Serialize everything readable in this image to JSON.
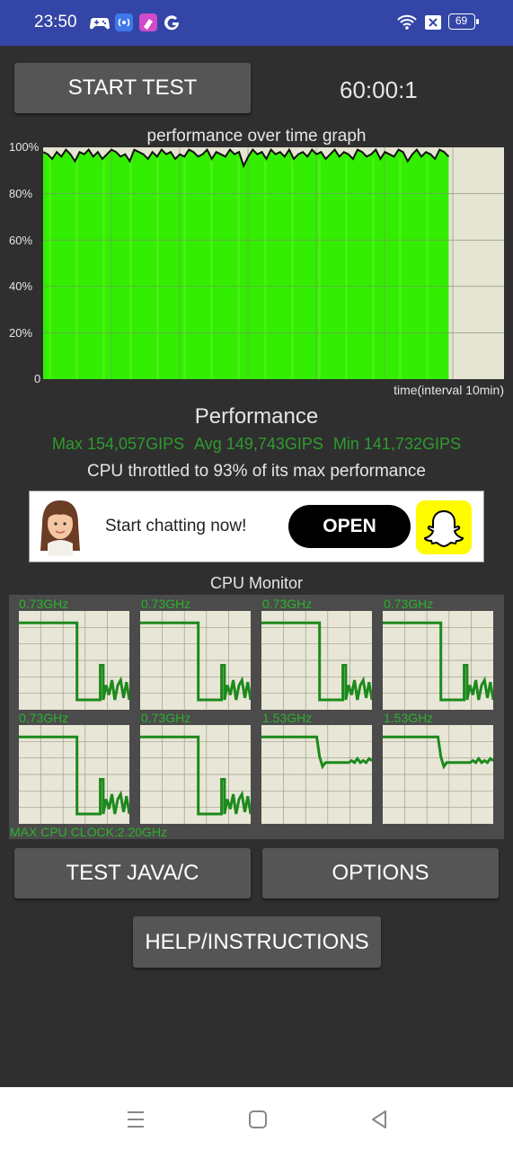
{
  "status_bar": {
    "time": "23:50",
    "battery": "69",
    "icons": [
      "gamepad-icon",
      "hotspot-icon",
      "app-icon",
      "google-icon",
      "wifi-icon",
      "close-box-icon",
      "battery-icon"
    ]
  },
  "controls": {
    "start_label": "START TEST",
    "timer": "60:00:1"
  },
  "graph": {
    "title": "performance over time graph",
    "y_ticks": [
      "100%",
      "80%",
      "60%",
      "40%",
      "20%",
      "0"
    ],
    "x_label": "time(interval 10min)"
  },
  "chart_data": {
    "type": "area",
    "title": "performance over time graph",
    "xlabel": "time(interval 10min)",
    "ylabel": "",
    "ylim": [
      0,
      100
    ],
    "y_ticks": [
      "0",
      "20%",
      "40%",
      "60%",
      "80%",
      "100%"
    ],
    "fill_color": "#33ee00",
    "line_color": "#111111",
    "filled_fraction_of_x": 0.88,
    "values": [
      98,
      97,
      95,
      98,
      96,
      99,
      97,
      94,
      98,
      97,
      99,
      96,
      98,
      95,
      97,
      99,
      98,
      96,
      97,
      94,
      99,
      98,
      97,
      95,
      98,
      96,
      99,
      97,
      98,
      95,
      97,
      96,
      99,
      98,
      96,
      97,
      99,
      95,
      98,
      97,
      96,
      99,
      97,
      98,
      92,
      96,
      99,
      97,
      98,
      95,
      99,
      97,
      98,
      96,
      99,
      95,
      97,
      98,
      96,
      99,
      97,
      98,
      95,
      97,
      99,
      96,
      98,
      97,
      95,
      99,
      98,
      96,
      97,
      99,
      95,
      98,
      97,
      96,
      99,
      98,
      94,
      97,
      99,
      96,
      98,
      97,
      95,
      99,
      98,
      96
    ]
  },
  "performance": {
    "title": "Performance",
    "max": "Max 154,057GIPS",
    "avg": "Avg 149,743GIPS",
    "min": "Min 141,732GIPS",
    "throttle": "CPU throttled to 93% of its max performance"
  },
  "ad": {
    "text": "Start chatting now!",
    "button": "OPEN"
  },
  "cpu_monitor": {
    "title": "CPU Monitor",
    "cores": [
      {
        "label": "0.73GHz",
        "values": [
          0.88,
          0.88,
          0.88,
          0.88,
          0.88,
          0.88,
          0.88,
          0.88,
          0.88,
          0.88,
          0.88,
          0.88,
          0.88,
          0.88,
          0.88,
          0.88,
          0.88,
          0.88,
          0.88,
          0.88,
          0.1,
          0.1,
          0.1,
          0.1,
          0.1,
          0.1,
          0.1,
          0.1,
          0.45,
          0.1,
          0.25,
          0.15,
          0.3,
          0.1,
          0.25,
          0.3,
          0.12,
          0.28,
          0.1
        ]
      },
      {
        "label": "0.73GHz",
        "values": [
          0.88,
          0.88,
          0.88,
          0.88,
          0.88,
          0.88,
          0.88,
          0.88,
          0.88,
          0.88,
          0.88,
          0.88,
          0.88,
          0.88,
          0.88,
          0.88,
          0.88,
          0.88,
          0.88,
          0.88,
          0.1,
          0.1,
          0.1,
          0.1,
          0.1,
          0.1,
          0.1,
          0.1,
          0.45,
          0.1,
          0.25,
          0.15,
          0.3,
          0.1,
          0.25,
          0.3,
          0.12,
          0.28,
          0.1
        ]
      },
      {
        "label": "0.73GHz",
        "values": [
          0.88,
          0.88,
          0.88,
          0.88,
          0.88,
          0.88,
          0.88,
          0.88,
          0.88,
          0.88,
          0.88,
          0.88,
          0.88,
          0.88,
          0.88,
          0.88,
          0.88,
          0.88,
          0.88,
          0.88,
          0.1,
          0.1,
          0.1,
          0.1,
          0.1,
          0.1,
          0.1,
          0.1,
          0.45,
          0.1,
          0.25,
          0.15,
          0.3,
          0.1,
          0.25,
          0.3,
          0.12,
          0.28,
          0.1
        ]
      },
      {
        "label": "0.73GHz",
        "values": [
          0.88,
          0.88,
          0.88,
          0.88,
          0.88,
          0.88,
          0.88,
          0.88,
          0.88,
          0.88,
          0.88,
          0.88,
          0.88,
          0.88,
          0.88,
          0.88,
          0.88,
          0.88,
          0.88,
          0.88,
          0.1,
          0.1,
          0.1,
          0.1,
          0.1,
          0.1,
          0.1,
          0.1,
          0.45,
          0.1,
          0.25,
          0.15,
          0.3,
          0.1,
          0.25,
          0.3,
          0.12,
          0.28,
          0.1
        ]
      },
      {
        "label": "0.73GHz",
        "values": [
          0.88,
          0.88,
          0.88,
          0.88,
          0.88,
          0.88,
          0.88,
          0.88,
          0.88,
          0.88,
          0.88,
          0.88,
          0.88,
          0.88,
          0.88,
          0.88,
          0.88,
          0.88,
          0.88,
          0.88,
          0.1,
          0.1,
          0.1,
          0.1,
          0.1,
          0.1,
          0.1,
          0.1,
          0.45,
          0.1,
          0.25,
          0.15,
          0.3,
          0.1,
          0.25,
          0.3,
          0.12,
          0.28,
          0.1
        ]
      },
      {
        "label": "0.73GHz",
        "values": [
          0.88,
          0.88,
          0.88,
          0.88,
          0.88,
          0.88,
          0.88,
          0.88,
          0.88,
          0.88,
          0.88,
          0.88,
          0.88,
          0.88,
          0.88,
          0.88,
          0.88,
          0.88,
          0.88,
          0.88,
          0.1,
          0.1,
          0.1,
          0.1,
          0.1,
          0.1,
          0.1,
          0.1,
          0.45,
          0.1,
          0.25,
          0.15,
          0.3,
          0.1,
          0.25,
          0.3,
          0.12,
          0.28,
          0.1
        ]
      },
      {
        "label": "1.53GHz",
        "values": [
          0.88,
          0.88,
          0.88,
          0.88,
          0.88,
          0.88,
          0.88,
          0.88,
          0.88,
          0.88,
          0.88,
          0.88,
          0.88,
          0.88,
          0.88,
          0.88,
          0.88,
          0.88,
          0.88,
          0.88,
          0.68,
          0.58,
          0.62,
          0.62,
          0.62,
          0.62,
          0.62,
          0.62,
          0.62,
          0.62,
          0.62,
          0.64,
          0.62,
          0.66,
          0.62,
          0.64,
          0.62,
          0.66,
          0.64
        ]
      },
      {
        "label": "1.53GHz",
        "values": [
          0.88,
          0.88,
          0.88,
          0.88,
          0.88,
          0.88,
          0.88,
          0.88,
          0.88,
          0.88,
          0.88,
          0.88,
          0.88,
          0.88,
          0.88,
          0.88,
          0.88,
          0.88,
          0.88,
          0.88,
          0.68,
          0.58,
          0.62,
          0.62,
          0.62,
          0.62,
          0.62,
          0.62,
          0.62,
          0.62,
          0.62,
          0.64,
          0.62,
          0.66,
          0.62,
          0.64,
          0.62,
          0.66,
          0.64
        ]
      }
    ],
    "max_clock": "MAX CPU CLOCK:2.20GHz"
  },
  "buttons": {
    "test_java": "TEST JAVA/C",
    "options": "OPTIONS",
    "help": "HELP/INSTRUCTIONS"
  },
  "colors": {
    "accent_green": "#2e9b2e",
    "graph_green": "#33ee00",
    "status_bar_blue": "#3345a6",
    "background": "#2f2f2f"
  }
}
